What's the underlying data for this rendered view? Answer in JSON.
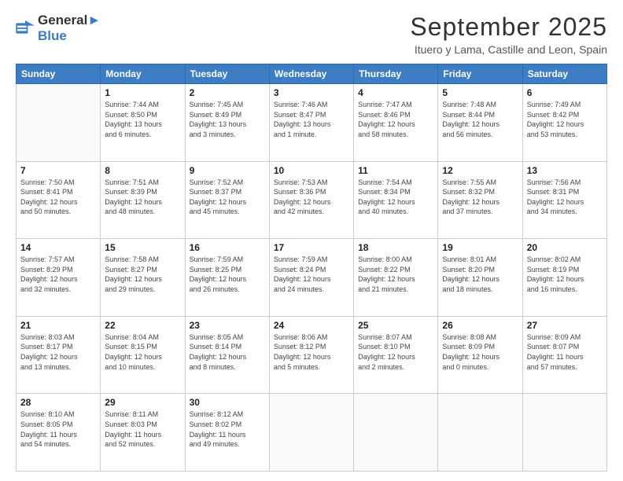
{
  "logo": {
    "line1": "General",
    "line2": "Blue"
  },
  "header": {
    "month": "September 2025",
    "location": "Ituero y Lama, Castille and Leon, Spain"
  },
  "days_of_week": [
    "Sunday",
    "Monday",
    "Tuesday",
    "Wednesday",
    "Thursday",
    "Friday",
    "Saturday"
  ],
  "weeks": [
    [
      {
        "day": "",
        "info": ""
      },
      {
        "day": "1",
        "info": "Sunrise: 7:44 AM\nSunset: 8:50 PM\nDaylight: 13 hours\nand 6 minutes."
      },
      {
        "day": "2",
        "info": "Sunrise: 7:45 AM\nSunset: 8:49 PM\nDaylight: 13 hours\nand 3 minutes."
      },
      {
        "day": "3",
        "info": "Sunrise: 7:46 AM\nSunset: 8:47 PM\nDaylight: 13 hours\nand 1 minute."
      },
      {
        "day": "4",
        "info": "Sunrise: 7:47 AM\nSunset: 8:46 PM\nDaylight: 12 hours\nand 58 minutes."
      },
      {
        "day": "5",
        "info": "Sunrise: 7:48 AM\nSunset: 8:44 PM\nDaylight: 12 hours\nand 56 minutes."
      },
      {
        "day": "6",
        "info": "Sunrise: 7:49 AM\nSunset: 8:42 PM\nDaylight: 12 hours\nand 53 minutes."
      }
    ],
    [
      {
        "day": "7",
        "info": "Sunrise: 7:50 AM\nSunset: 8:41 PM\nDaylight: 12 hours\nand 50 minutes."
      },
      {
        "day": "8",
        "info": "Sunrise: 7:51 AM\nSunset: 8:39 PM\nDaylight: 12 hours\nand 48 minutes."
      },
      {
        "day": "9",
        "info": "Sunrise: 7:52 AM\nSunset: 8:37 PM\nDaylight: 12 hours\nand 45 minutes."
      },
      {
        "day": "10",
        "info": "Sunrise: 7:53 AM\nSunset: 8:36 PM\nDaylight: 12 hours\nand 42 minutes."
      },
      {
        "day": "11",
        "info": "Sunrise: 7:54 AM\nSunset: 8:34 PM\nDaylight: 12 hours\nand 40 minutes."
      },
      {
        "day": "12",
        "info": "Sunrise: 7:55 AM\nSunset: 8:32 PM\nDaylight: 12 hours\nand 37 minutes."
      },
      {
        "day": "13",
        "info": "Sunrise: 7:56 AM\nSunset: 8:31 PM\nDaylight: 12 hours\nand 34 minutes."
      }
    ],
    [
      {
        "day": "14",
        "info": "Sunrise: 7:57 AM\nSunset: 8:29 PM\nDaylight: 12 hours\nand 32 minutes."
      },
      {
        "day": "15",
        "info": "Sunrise: 7:58 AM\nSunset: 8:27 PM\nDaylight: 12 hours\nand 29 minutes."
      },
      {
        "day": "16",
        "info": "Sunrise: 7:59 AM\nSunset: 8:25 PM\nDaylight: 12 hours\nand 26 minutes."
      },
      {
        "day": "17",
        "info": "Sunrise: 7:59 AM\nSunset: 8:24 PM\nDaylight: 12 hours\nand 24 minutes."
      },
      {
        "day": "18",
        "info": "Sunrise: 8:00 AM\nSunset: 8:22 PM\nDaylight: 12 hours\nand 21 minutes."
      },
      {
        "day": "19",
        "info": "Sunrise: 8:01 AM\nSunset: 8:20 PM\nDaylight: 12 hours\nand 18 minutes."
      },
      {
        "day": "20",
        "info": "Sunrise: 8:02 AM\nSunset: 8:19 PM\nDaylight: 12 hours\nand 16 minutes."
      }
    ],
    [
      {
        "day": "21",
        "info": "Sunrise: 8:03 AM\nSunset: 8:17 PM\nDaylight: 12 hours\nand 13 minutes."
      },
      {
        "day": "22",
        "info": "Sunrise: 8:04 AM\nSunset: 8:15 PM\nDaylight: 12 hours\nand 10 minutes."
      },
      {
        "day": "23",
        "info": "Sunrise: 8:05 AM\nSunset: 8:14 PM\nDaylight: 12 hours\nand 8 minutes."
      },
      {
        "day": "24",
        "info": "Sunrise: 8:06 AM\nSunset: 8:12 PM\nDaylight: 12 hours\nand 5 minutes."
      },
      {
        "day": "25",
        "info": "Sunrise: 8:07 AM\nSunset: 8:10 PM\nDaylight: 12 hours\nand 2 minutes."
      },
      {
        "day": "26",
        "info": "Sunrise: 8:08 AM\nSunset: 8:09 PM\nDaylight: 12 hours\nand 0 minutes."
      },
      {
        "day": "27",
        "info": "Sunrise: 8:09 AM\nSunset: 8:07 PM\nDaylight: 11 hours\nand 57 minutes."
      }
    ],
    [
      {
        "day": "28",
        "info": "Sunrise: 8:10 AM\nSunset: 8:05 PM\nDaylight: 11 hours\nand 54 minutes."
      },
      {
        "day": "29",
        "info": "Sunrise: 8:11 AM\nSunset: 8:03 PM\nDaylight: 11 hours\nand 52 minutes."
      },
      {
        "day": "30",
        "info": "Sunrise: 8:12 AM\nSunset: 8:02 PM\nDaylight: 11 hours\nand 49 minutes."
      },
      {
        "day": "",
        "info": ""
      },
      {
        "day": "",
        "info": ""
      },
      {
        "day": "",
        "info": ""
      },
      {
        "day": "",
        "info": ""
      }
    ]
  ]
}
